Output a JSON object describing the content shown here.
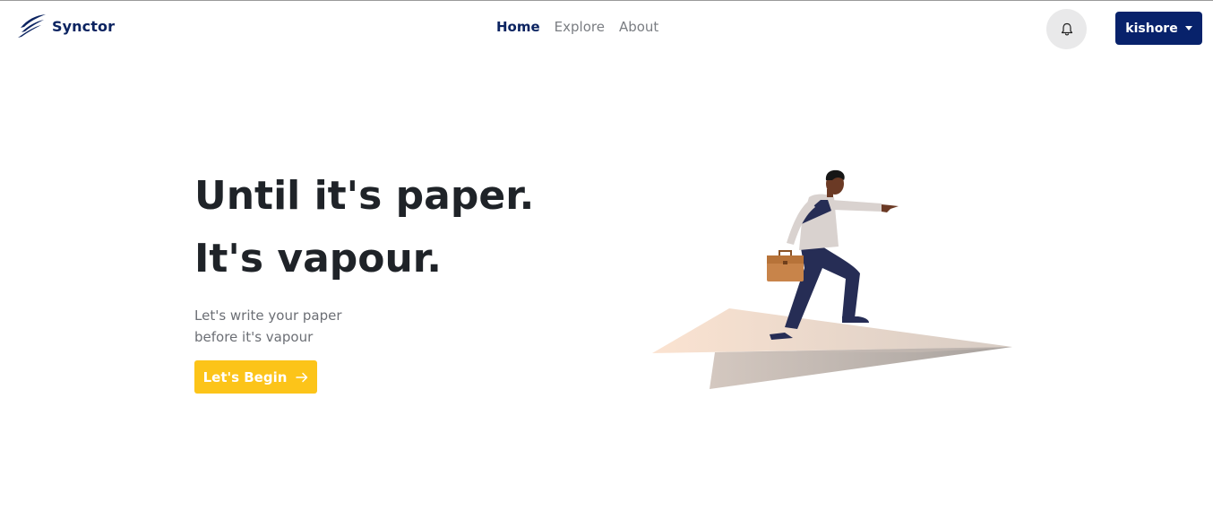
{
  "brand": {
    "name": "Synctor",
    "logo_icon": "feather-wing-icon",
    "color": "#0c2461"
  },
  "nav": {
    "items": [
      {
        "label": "Home",
        "active": true
      },
      {
        "label": "Explore",
        "active": false
      },
      {
        "label": "About",
        "active": false
      }
    ]
  },
  "header_actions": {
    "notifications_icon": "bell-icon",
    "user_menu_label": "kishore",
    "user_menu_color": "#08226b"
  },
  "hero": {
    "title_line1": "Until it's paper.",
    "title_line2": "It's vapour.",
    "subtitle_line1": "Let's write your paper",
    "subtitle_line2": "before it's vapour",
    "cta_label": "Let's Begin",
    "cta_icon": "arrow-right-icon",
    "cta_color": "#fcc419",
    "illustration": "man-on-paper-plane-illustration"
  }
}
